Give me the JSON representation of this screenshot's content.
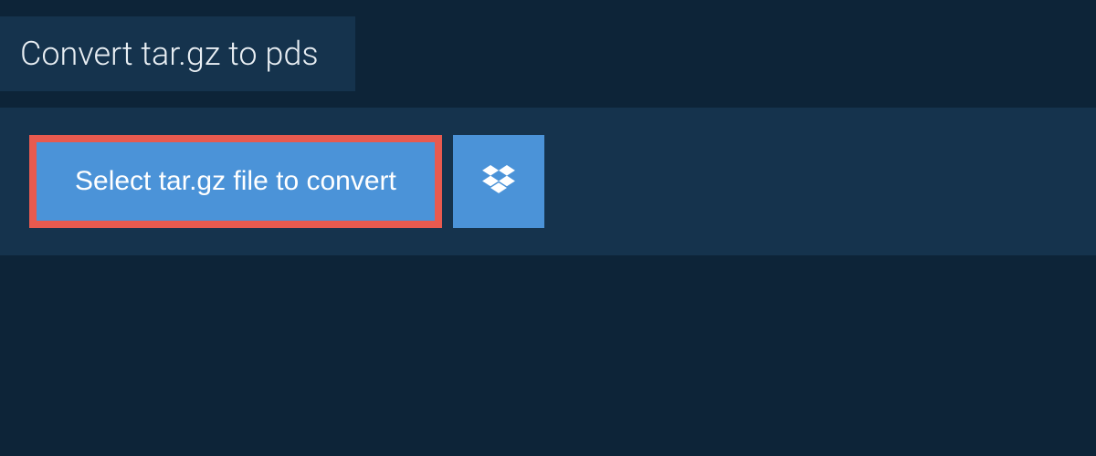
{
  "header": {
    "title": "Convert tar.gz to pds"
  },
  "actions": {
    "select_button_label": "Select tar.gz file to convert"
  },
  "colors": {
    "background": "#0d2438",
    "panel": "#15334d",
    "button": "#4b93d8",
    "highlight_border": "#e85a4f",
    "text_light": "#e8eef3"
  }
}
